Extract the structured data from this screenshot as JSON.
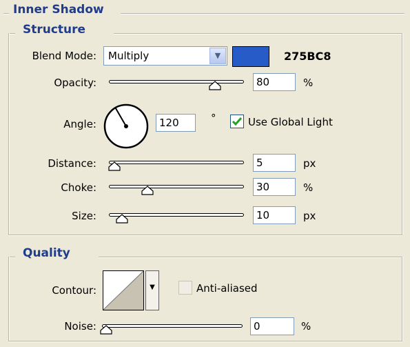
{
  "inner_shadow": {
    "title": "Inner Shadow",
    "structure": {
      "title": "Structure",
      "blend_mode": {
        "label": "Blend Mode:",
        "value": "Multiply"
      },
      "color": {
        "hex_label": "275BC8",
        "swatch": "#275bc8"
      },
      "opacity": {
        "label": "Opacity:",
        "value": "80",
        "unit": "%",
        "level": 0.8
      },
      "angle": {
        "label": "Angle:",
        "value": "120",
        "unit": "°",
        "degrees": 120
      },
      "use_global_light": {
        "label": "Use Global Light",
        "checked": true
      },
      "distance": {
        "label": "Distance:",
        "value": "5",
        "unit": "px",
        "level": 0.0
      },
      "choke": {
        "label": "Choke:",
        "value": "30",
        "unit": "%",
        "level": 0.3
      },
      "size": {
        "label": "Size:",
        "value": "10",
        "unit": "px",
        "level": 0.05
      }
    },
    "quality": {
      "title": "Quality",
      "contour": {
        "label": "Contour:"
      },
      "anti_aliased": {
        "label": "Anti-aliased",
        "checked": false
      },
      "noise": {
        "label": "Noise:",
        "value": "0",
        "unit": "%",
        "level": 0.0
      }
    }
  }
}
